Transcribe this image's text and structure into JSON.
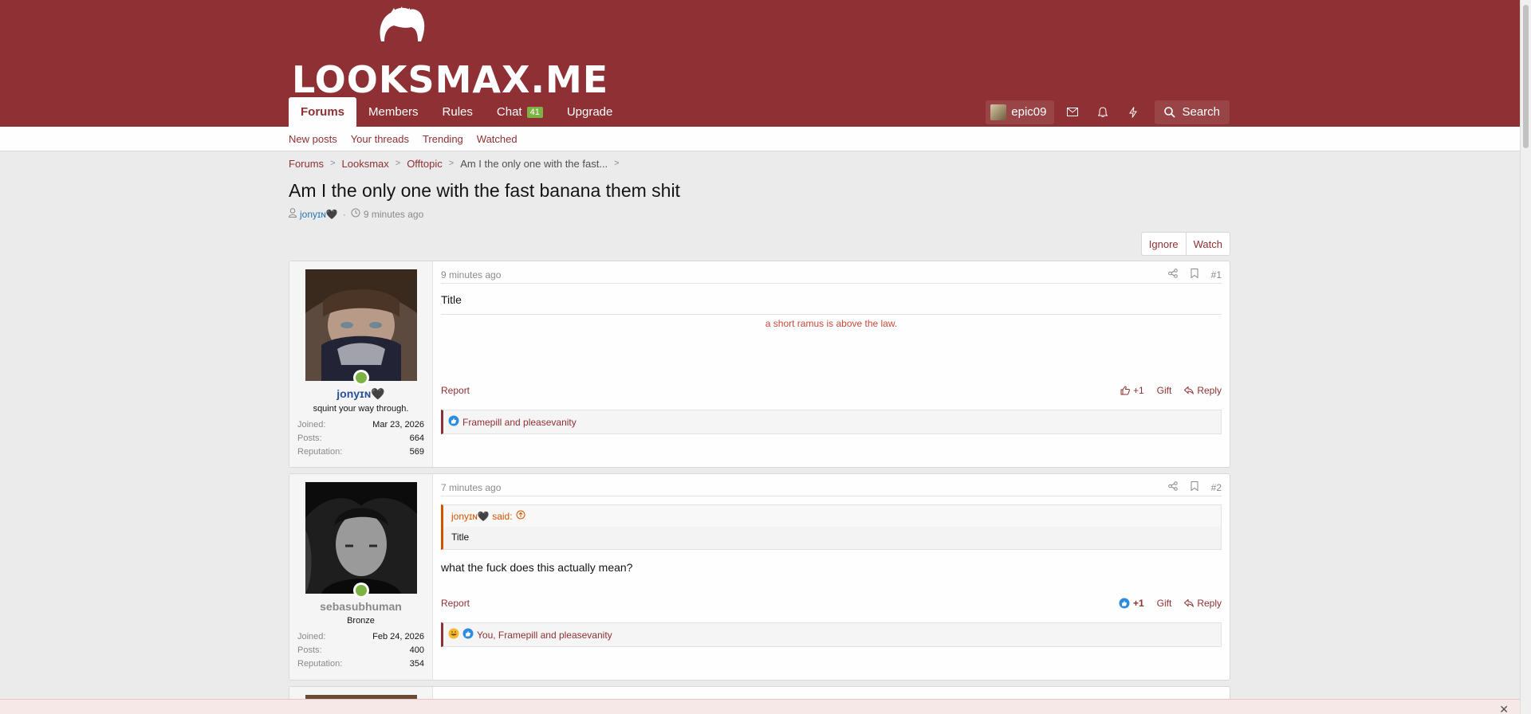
{
  "site": {
    "logo_text": "LOOKSMAX.ME"
  },
  "nav": {
    "tabs": [
      {
        "label": "Forums"
      },
      {
        "label": "Members"
      },
      {
        "label": "Rules"
      },
      {
        "label": "Chat"
      },
      {
        "label": "Upgrade"
      }
    ],
    "chat_badge": "41",
    "username": "epic09",
    "search_label": "Search"
  },
  "subnav": [
    "New posts",
    "Your threads",
    "Trending",
    "Watched"
  ],
  "breadcrumb": [
    "Forums",
    "Looksmax",
    "Offtopic",
    "Am I the only one with the fast..."
  ],
  "thread": {
    "title": "Am I the only one with the fast banana them shit",
    "author": "jonyɪɴ🖤",
    "time": "9 minutes ago",
    "ignore_label": "Ignore",
    "watch_label": "Watch"
  },
  "posts": [
    {
      "username": "jonyɪɴ🖤",
      "user_title": "squint your way through.",
      "joined": "Mar 23, 2026",
      "posts": "664",
      "reputation": "569",
      "time": "9 minutes ago",
      "number": "#1",
      "body": "Title",
      "signature": "a short ramus is above the law.",
      "report": "Report",
      "like": "+1",
      "gift": "Gift",
      "reply": "Reply",
      "reactions": "Framepill and pleasevanity"
    },
    {
      "username": "sebasubhuman",
      "user_title": "Bronze",
      "joined": "Feb 24, 2026",
      "posts": "400",
      "reputation": "354",
      "time": "7 minutes ago",
      "number": "#2",
      "quote_author": "jonyɪɴ🖤 said:",
      "quote_body": "Title",
      "body": "what the fuck does this actually mean?",
      "report": "Report",
      "like": "+1",
      "gift": "Gift",
      "reply": "Reply",
      "reactions": "You, Framepill and pleasevanity"
    }
  ],
  "stat_labels": {
    "joined": "Joined:",
    "posts": "Posts:",
    "reputation": "Reputation:"
  },
  "colors": {
    "brand": "#8e3034",
    "online": "#7cb342",
    "quote": "#d35400"
  }
}
